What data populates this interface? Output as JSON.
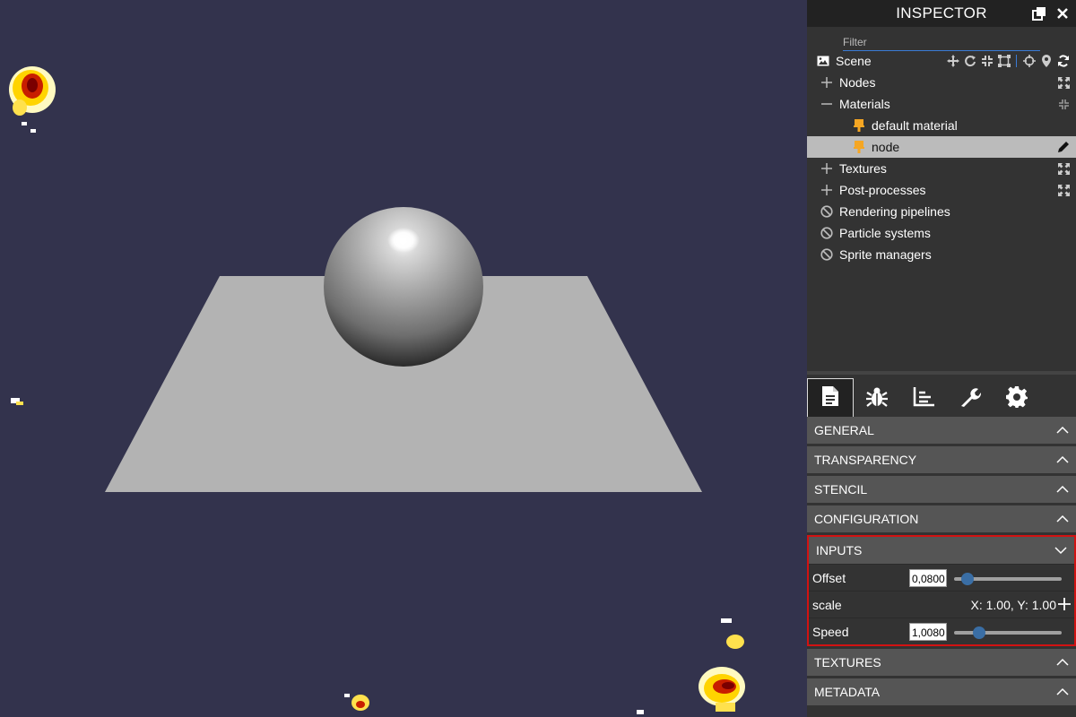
{
  "inspector": {
    "title": "INSPECTOR",
    "filter_placeholder": "Filter"
  },
  "tree": {
    "scene_label": "Scene",
    "items": [
      {
        "label": "Nodes",
        "expander": "plus"
      },
      {
        "label": "Materials",
        "expander": "minus"
      },
      {
        "label": "default material",
        "child": true
      },
      {
        "label": "node",
        "child": true,
        "selected": true
      },
      {
        "label": "Textures",
        "expander": "plus"
      },
      {
        "label": "Post-processes",
        "expander": "plus"
      },
      {
        "label": "Rendering pipelines",
        "expander": "disabled"
      },
      {
        "label": "Particle systems",
        "expander": "disabled"
      },
      {
        "label": "Sprite managers",
        "expander": "disabled"
      }
    ]
  },
  "tabs": [
    "properties",
    "debug",
    "statistics",
    "tools",
    "settings"
  ],
  "sections": {
    "general": "GENERAL",
    "transparency": "TRANSPARENCY",
    "stencil": "STENCIL",
    "configuration": "CONFIGURATION",
    "inputs": "INPUTS",
    "textures": "TEXTURES",
    "metadata": "METADATA"
  },
  "inputs": {
    "offset_label": "Offset",
    "offset_value": "0,0800",
    "offset_fraction": 0.08,
    "scale_label": "scale",
    "scale_value": "X: 1.00, Y: 1.00",
    "speed_label": "Speed",
    "speed_value": "1,0080",
    "speed_fraction": 0.2
  },
  "colors": {
    "viewport_bg": "#33334d",
    "panel_bg": "#333333",
    "header_bg": "#222222",
    "section_bg": "#555555",
    "highlight_border": "#d21212",
    "material_icon": "#f5a623",
    "slider_thumb": "#3a6ea5"
  }
}
